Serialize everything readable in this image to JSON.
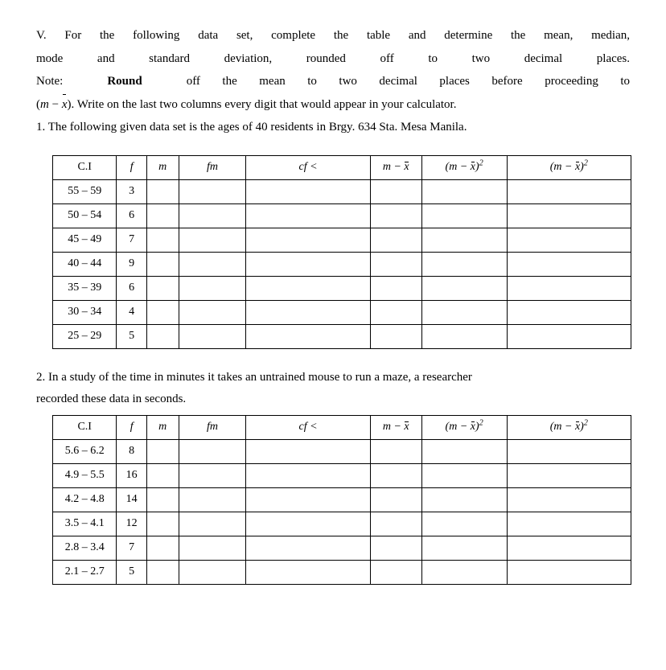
{
  "instructions": {
    "line1": "V. For the following data set, complete the table and determine the mean, median,",
    "line2": "mode and standard deviation, rounded off to two decimal places.",
    "line3_a": "Note:  ",
    "line3_bold": "Round",
    "line3_b": "  off the mean to two decimal places before proceeding to",
    "line4": "(m − x̄). Write on the last two columns every digit that would appear in your calculator.",
    "line5": "1. The following given data set is the ages of 40 residents in Brgy. 634 Sta. Mesa Manila."
  },
  "headers": {
    "ci": "C.I",
    "f": "f",
    "m": "m",
    "fm": "fm",
    "cf": "cf <",
    "mmx": "m − x̄",
    "mmx2": "(m − x̄)²",
    "mmx2b": "(m − x̄)²"
  },
  "table1": [
    {
      "ci": "55 – 59",
      "f": "3"
    },
    {
      "ci": "50 – 54",
      "f": "6"
    },
    {
      "ci": "45 – 49",
      "f": "7"
    },
    {
      "ci": "40 – 44",
      "f": "9"
    },
    {
      "ci": "35 – 39",
      "f": "6"
    },
    {
      "ci": "30 – 34",
      "f": "4"
    },
    {
      "ci": "25 – 29",
      "f": "5"
    }
  ],
  "section2": {
    "text1": "2. In a study of the time in minutes it takes an untrained mouse to run a maze, a researcher",
    "text2": "recorded these data in seconds."
  },
  "table2": [
    {
      "ci": "5.6 – 6.2",
      "f": "8"
    },
    {
      "ci": "4.9 – 5.5",
      "f": "16"
    },
    {
      "ci": "4.2 – 4.8",
      "f": "14"
    },
    {
      "ci": "3.5 – 4.1",
      "f": "12"
    },
    {
      "ci": "2.8 – 3.4",
      "f": "7"
    },
    {
      "ci": "2.1 – 2.7",
      "f": "5"
    }
  ]
}
